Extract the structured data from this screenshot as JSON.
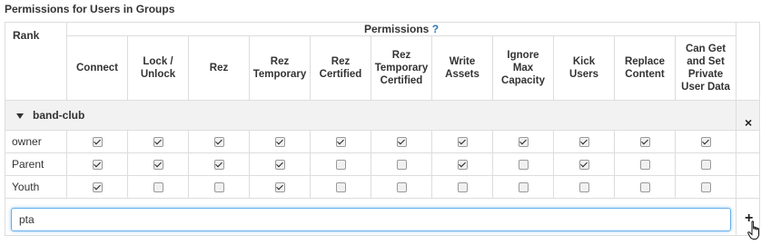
{
  "section_title": "Permissions for Users in Groups",
  "table": {
    "rank_header": "Rank",
    "permissions_header": "Permissions",
    "help_mark": "?",
    "columns": [
      [
        "Connect"
      ],
      [
        "Lock /",
        "Unlock"
      ],
      [
        "Rez"
      ],
      [
        "Rez",
        "Temporary"
      ],
      [
        "Rez",
        "Certified"
      ],
      [
        "Rez",
        "Temporary",
        "Certified"
      ],
      [
        "Write",
        "Assets"
      ],
      [
        "Ignore",
        "Max",
        "Capacity"
      ],
      [
        "Kick",
        "Users"
      ],
      [
        "Replace",
        "Content"
      ],
      [
        "Can Get",
        "and Set",
        "Private",
        "User Data"
      ]
    ],
    "group": {
      "name": "band-club",
      "remove_icon": "close-icon",
      "remove_glyph": "×"
    },
    "rows": [
      {
        "name": "owner",
        "perms": [
          true,
          true,
          true,
          true,
          true,
          true,
          true,
          true,
          true,
          true,
          true
        ]
      },
      {
        "name": "Parent",
        "perms": [
          true,
          true,
          true,
          true,
          false,
          false,
          true,
          false,
          true,
          false,
          false
        ]
      },
      {
        "name": "Youth",
        "perms": [
          true,
          false,
          false,
          true,
          false,
          false,
          false,
          false,
          false,
          false,
          false
        ]
      }
    ]
  },
  "new_rank_input": {
    "value": "pta"
  },
  "add_button": {
    "glyph": "+",
    "icon": "plus-icon"
  }
}
